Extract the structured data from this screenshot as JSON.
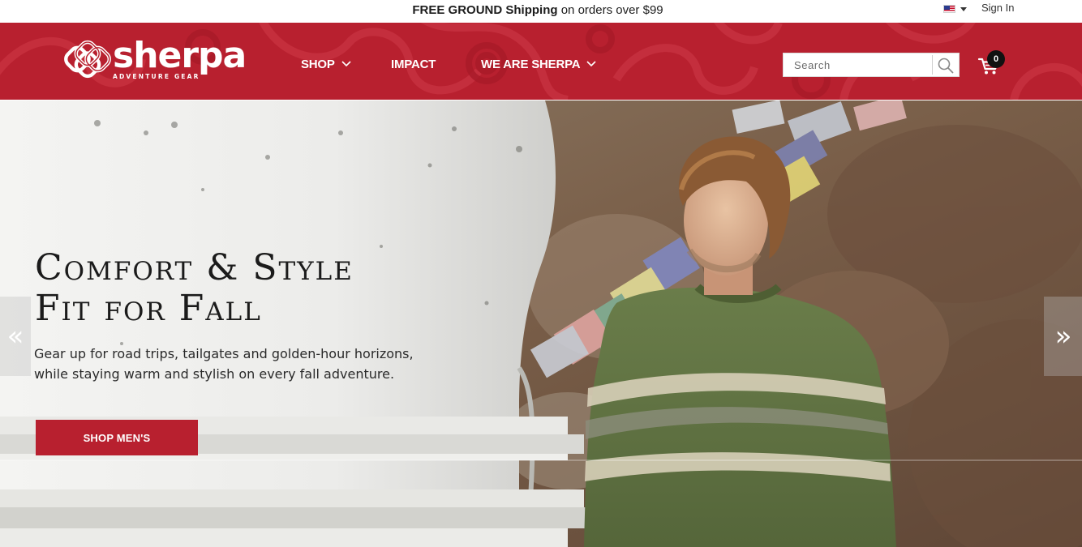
{
  "promo": {
    "bold": "FREE GROUND Shipping",
    "rest": " on orders over $99"
  },
  "account": {
    "sign_in": "Sign In",
    "country_icon": "us-flag-icon"
  },
  "brand": {
    "wordmark": "sherpa",
    "tagline": "ADVENTURE GEAR",
    "primary_color": "#b8202f"
  },
  "nav": {
    "items": [
      {
        "label": "SHOP",
        "has_dropdown": true
      },
      {
        "label": "IMPACT",
        "has_dropdown": false
      },
      {
        "label": "WE ARE SHERPA",
        "has_dropdown": true
      }
    ]
  },
  "search": {
    "placeholder": "Search",
    "value": "",
    "icon": "search-icon"
  },
  "cart": {
    "count": "0",
    "icon": "cart-icon"
  },
  "hero": {
    "title_line1": "Comfort & Style",
    "title_line2": "Fit for Fall",
    "copy_line1": "Gear up for road trips, tailgates and golden-hour horizons,",
    "copy_line2": "while staying warm and stylish on every fall adventure.",
    "cta": "SHOP MEN'S",
    "prev_arrow": "«",
    "next_arrow": "»"
  }
}
